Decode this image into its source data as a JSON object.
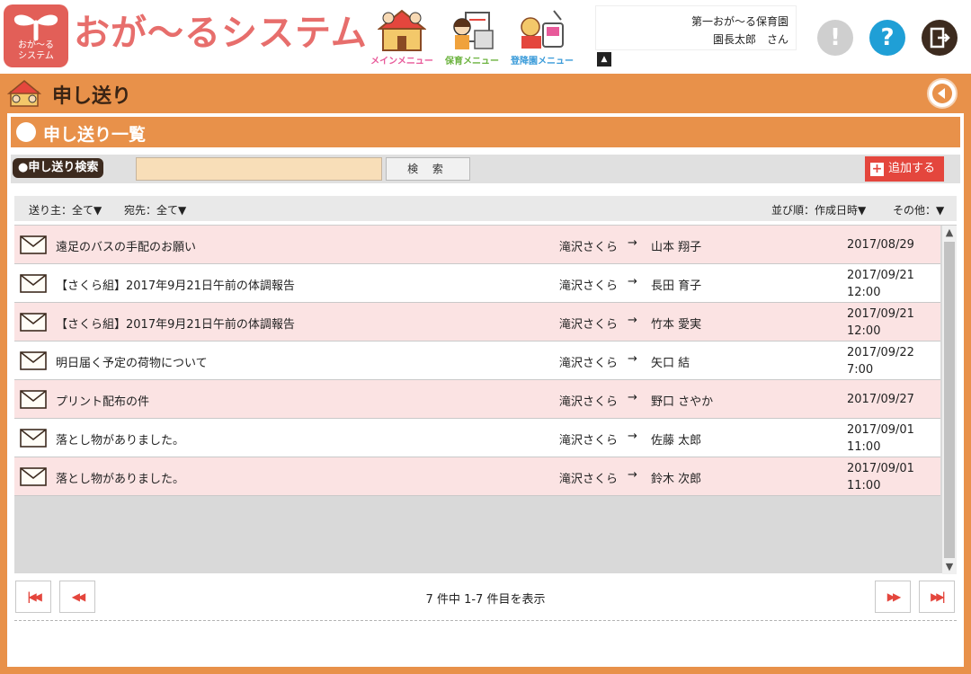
{
  "app": {
    "logo_text_line1": "おが～る",
    "logo_text_line2": "システム",
    "title": "おが～るシステム"
  },
  "nav": [
    {
      "label": "メインメニュー",
      "color": "#e85a9a"
    },
    {
      "label": "保育メニュー",
      "color": "#6cb33f"
    },
    {
      "label": "登降園メニュー",
      "color": "#3a9bd9"
    }
  ],
  "user": {
    "org": "第一おが～る保育園",
    "name": "園長太郎　さん"
  },
  "header_buttons": {
    "alert_icon": "exclamation-icon",
    "help_icon": "question-icon",
    "logout_icon": "logout-icon",
    "alert_symbol": "!",
    "help_symbol": "?"
  },
  "page": {
    "title": "申し送り"
  },
  "section": {
    "title": "申し送り一覧"
  },
  "search": {
    "label": "●申し送り検索",
    "value": "",
    "button": "検 索",
    "add_button": "追加する"
  },
  "filters": {
    "sender": "送り主：全て▼",
    "recipient": "宛先：全て▼",
    "sort": "並び順：作成日時▼",
    "other": "その他：▼"
  },
  "messages": [
    {
      "subject": "遠足のバスの手配のお願い",
      "from": "滝沢さくら",
      "to": "山本 翔子",
      "date": "2017/08/29"
    },
    {
      "subject": "【さくら組】2017年9月21日午前の体調報告",
      "from": "滝沢さくら",
      "to": "長田 育子",
      "date": "2017/09/21\n12:00"
    },
    {
      "subject": "【さくら組】2017年9月21日午前の体調報告",
      "from": "滝沢さくら",
      "to": "竹本 愛実",
      "date": "2017/09/21\n12:00"
    },
    {
      "subject": "明日届く予定の荷物について",
      "from": "滝沢さくら",
      "to": "矢口 結",
      "date": "2017/09/22\n7:00"
    },
    {
      "subject": "プリント配布の件",
      "from": "滝沢さくら",
      "to": "野口 さやか",
      "date": "2017/09/27"
    },
    {
      "subject": "落とし物がありました。",
      "from": "滝沢さくら",
      "to": "佐藤 太郎",
      "date": "2017/09/01\n11:00"
    },
    {
      "subject": "落とし物がありました。",
      "from": "滝沢さくら",
      "to": "鈴木 次郎",
      "date": "2017/09/01\n11:00"
    }
  ],
  "arrow_symbol": "→",
  "pager": {
    "info": "7 件中 1-7  件目を表示",
    "first": "◀◀",
    "prev": "◀◀",
    "next": "▶▶",
    "last": "▶▶"
  },
  "colors": {
    "brand_orange": "#e8914a",
    "brand_red": "#e4463d",
    "row_pink": "#fbe3e3",
    "help_blue": "#1f9fd6",
    "alert_gray": "#cfcfcf",
    "logout_dark": "#3d2b1f"
  }
}
